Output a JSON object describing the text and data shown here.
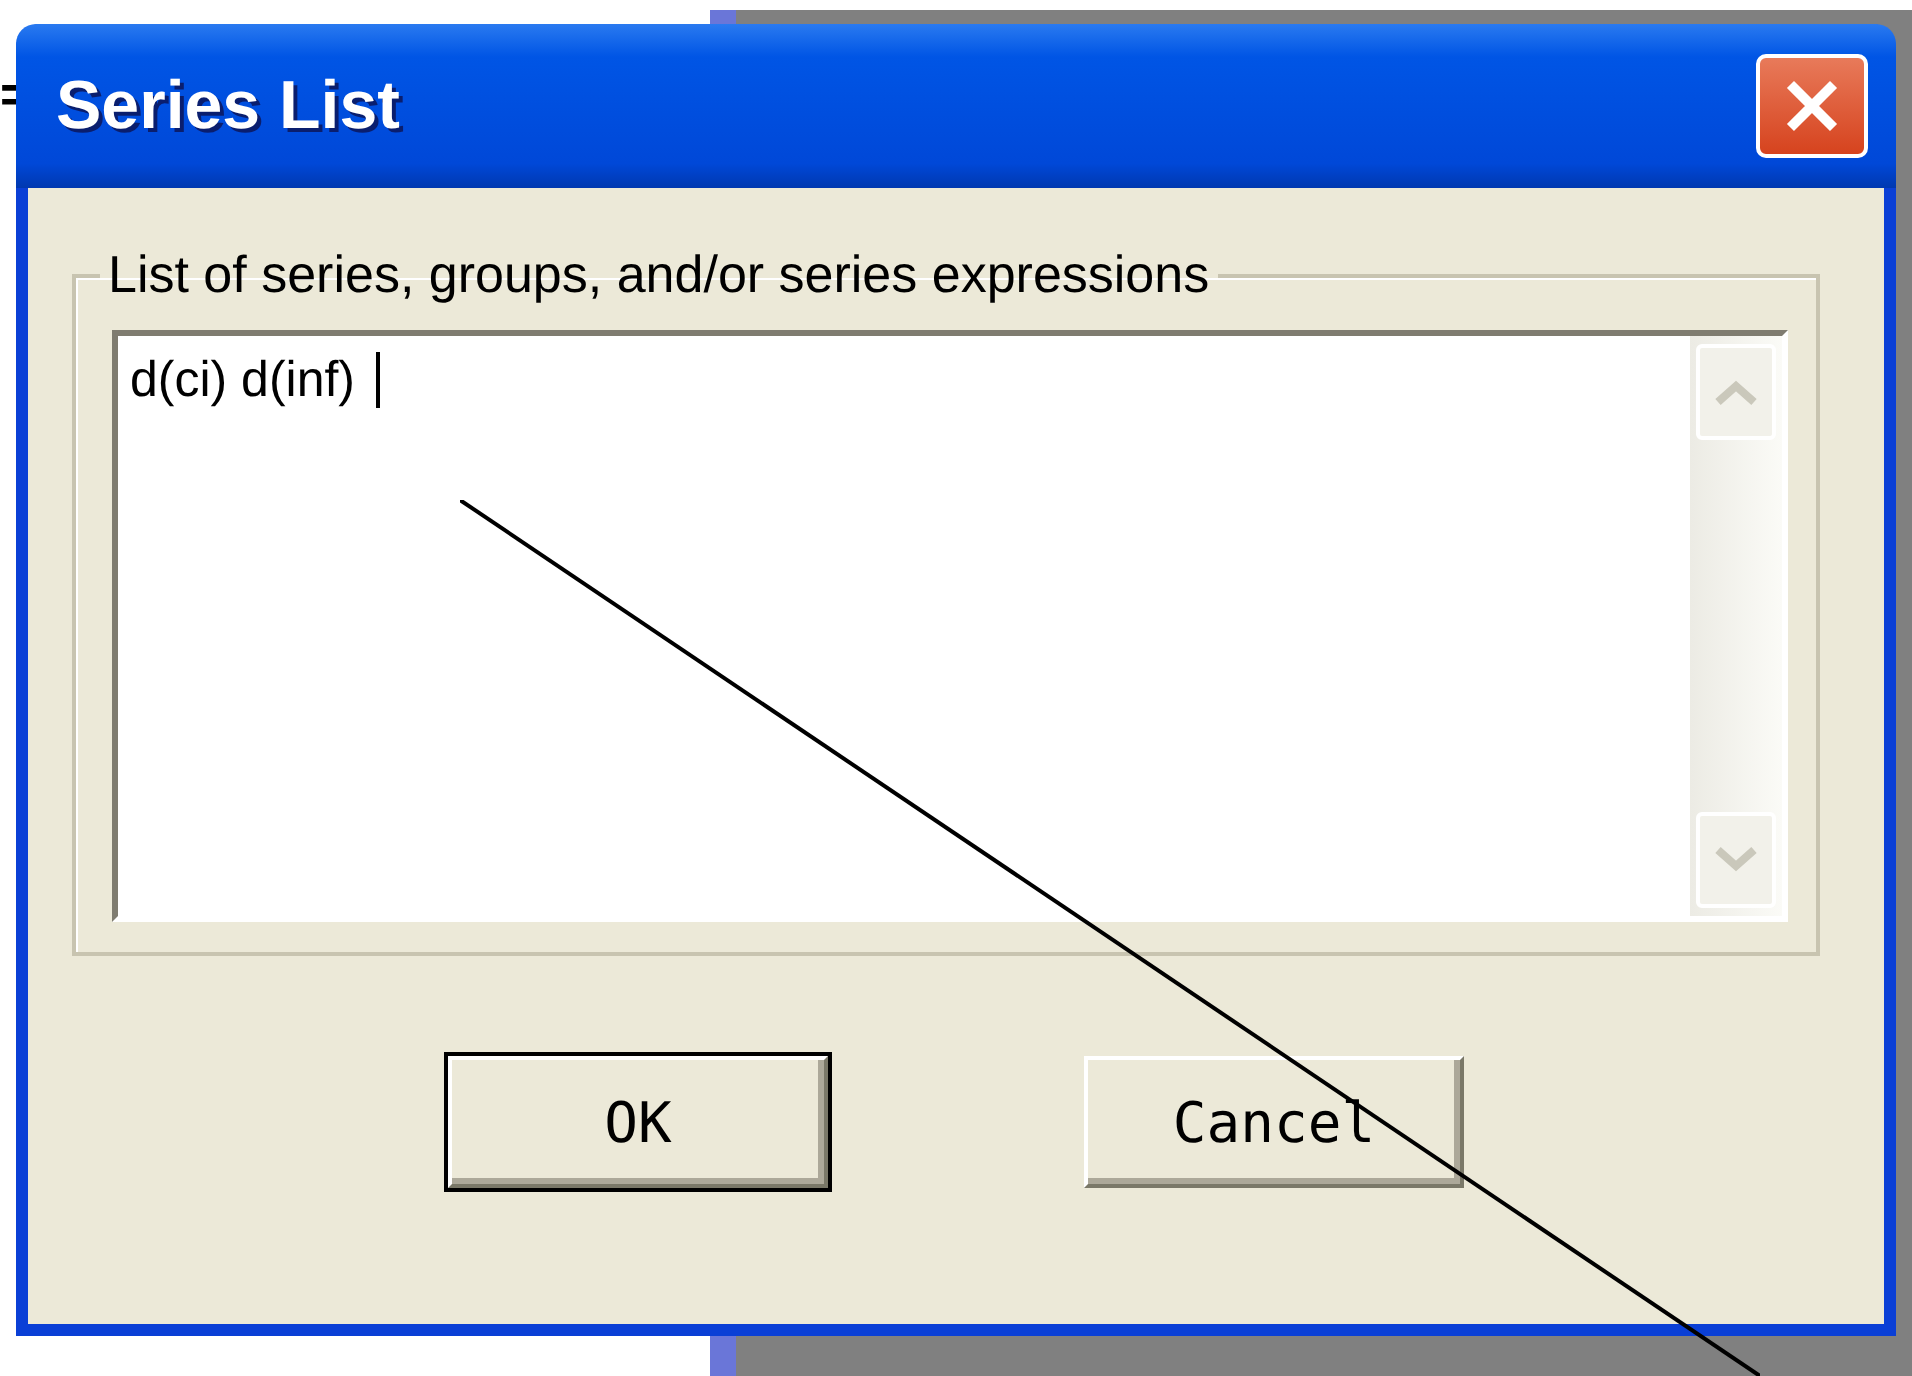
{
  "background_mark": "=",
  "window": {
    "title": "Series List"
  },
  "group": {
    "label": "List of series, groups, and/or series expressions",
    "value": "d(ci) d(inf)",
    "scrollbar_disabled": true
  },
  "buttons": [
    {
      "label": "OK",
      "default": true
    },
    {
      "label": "Cancel",
      "default": false
    }
  ]
}
